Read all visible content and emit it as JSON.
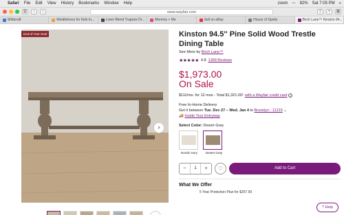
{
  "menubar": {
    "app": "Safari",
    "items": [
      "File",
      "Edit",
      "View",
      "History",
      "Bookmarks",
      "Window",
      "Help"
    ],
    "zoom": "zoom",
    "battery": "82%",
    "time": "Sat 7:05 PM"
  },
  "address": "www.wayfair.com",
  "tabs": [
    {
      "label": "Wildcraft",
      "color": "#3a7bd5"
    },
    {
      "label": "Mindfulness for Kids In...",
      "color": "#e8a33d"
    },
    {
      "label": "Linen Blend Trapeze Dr...",
      "color": "#444444"
    },
    {
      "label": "Mommy + Me",
      "color": "#d94f70"
    },
    {
      "label": "Sell on eBay",
      "color": "#e53238"
    },
    {
      "label": "House of Spoils",
      "color": "#777777"
    },
    {
      "label": "Birch Lane™ Kinston 94...",
      "color": "#7a1a7a"
    }
  ],
  "hero": {
    "badge": "End-of-Year Deal",
    "colors": {
      "floor": "#b89d7e",
      "wall": "#d4cfc7"
    }
  },
  "product": {
    "title": "Kinston 94.5'' Pine Solid Wood Trestle Dining Table",
    "see_more": "See More by",
    "brand": "Birch Lane™",
    "rating": "4.8",
    "reviews": "1399 Reviews",
    "stars": "★★★★★",
    "price": "$1,973.00",
    "sale": "On Sale",
    "credit_text": "$111/mo. for 12 mos - Total $1,321.00¹",
    "credit_link": "with a Wayfair credit card",
    "delivery_title": "Free In-Home Delivery",
    "delivery_prefix": "Get it between",
    "delivery_dates": "Tue. Dec 27 – Wed. Jan 4",
    "delivery_to": "to",
    "zip": "Brooklyn - 11215",
    "entryway": "Inside Your Entryway",
    "color_label": "Select Color:",
    "color_value": "Desert Gray",
    "swatches": [
      {
        "label": "Nordic Ivory",
        "color": "#e3ddd2"
      },
      {
        "label": "Desert Gray",
        "color": "#9c8a72"
      }
    ],
    "qty": "1",
    "cart_label": "Add to Cart",
    "offer_title": "What We Offer",
    "plan": "5 Year Protection Plan for $257.99"
  },
  "help": "Help",
  "accent": "#7a1a7a",
  "price_color": "#b0124a"
}
